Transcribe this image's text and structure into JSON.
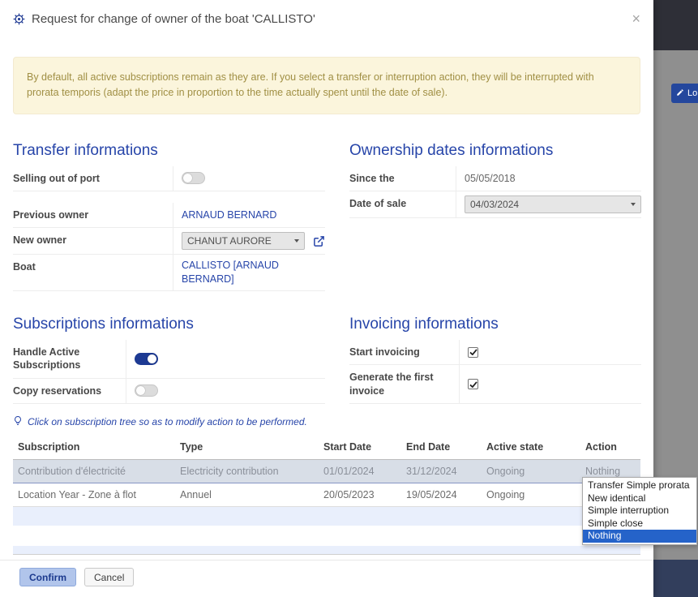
{
  "modal": {
    "title": "Request for change of owner of the boat 'CALLISTO'",
    "close_label": "×",
    "warning": "By default, all active subscriptions remain as they are. If you select a transfer or interruption action, they will be interrupted with prorata temporis (adapt the price in proportion to the time actually spent until the date of sale).",
    "transfer": {
      "title": "Transfer informations",
      "selling_label": "Selling out of port",
      "previous_owner_label": "Previous owner",
      "previous_owner_value": "ARNAUD BERNARD",
      "new_owner_label": "New owner",
      "new_owner_value": "CHANUT AURORE",
      "boat_label": "Boat",
      "boat_value": "CALLISTO [ARNAUD BERNARD]"
    },
    "ownership": {
      "title": "Ownership dates informations",
      "since_label": "Since the",
      "since_value": "05/05/2018",
      "sale_label": "Date of sale",
      "sale_value": "04/03/2024"
    },
    "subscriptions": {
      "title": "Subscriptions informations",
      "handle_label": "Handle Active Subscriptions",
      "copy_label": "Copy reservations"
    },
    "invoicing": {
      "title": "Invoicing informations",
      "start_label": "Start invoicing",
      "generate_label": "Generate the first invoice"
    },
    "hint": "Click on subscription tree so as to modify action to be performed.",
    "table": {
      "headers": [
        "Subscription",
        "Type",
        "Start Date",
        "End Date",
        "Active state",
        "Action"
      ],
      "rows": [
        {
          "subscription": "Contribution d'électricité",
          "type": "Electricity contribution",
          "start_date": "01/01/2024",
          "end_date": "31/12/2024",
          "active_state": "Ongoing",
          "action": "Nothing"
        },
        {
          "subscription": "Location Year - Zone à flot",
          "type": "Annuel",
          "start_date": "20/05/2023",
          "end_date": "19/05/2024",
          "active_state": "Ongoing",
          "action": "Nothing"
        }
      ]
    },
    "action_dropdown": {
      "options": [
        "Transfer Simple prorata",
        "New identical",
        "Simple interruption",
        "Simple close",
        "Nothing"
      ],
      "selected": "Nothing"
    },
    "footer": {
      "confirm_label": "Confirm",
      "cancel_label": "Cancel"
    }
  },
  "background": {
    "log_button_label": "Lo"
  },
  "colors": {
    "accent_blue": "#2745a9",
    "toggle_on": "#1d3a93",
    "dropdown_highlight": "#2563c9",
    "warning_text": "#a08f44"
  }
}
